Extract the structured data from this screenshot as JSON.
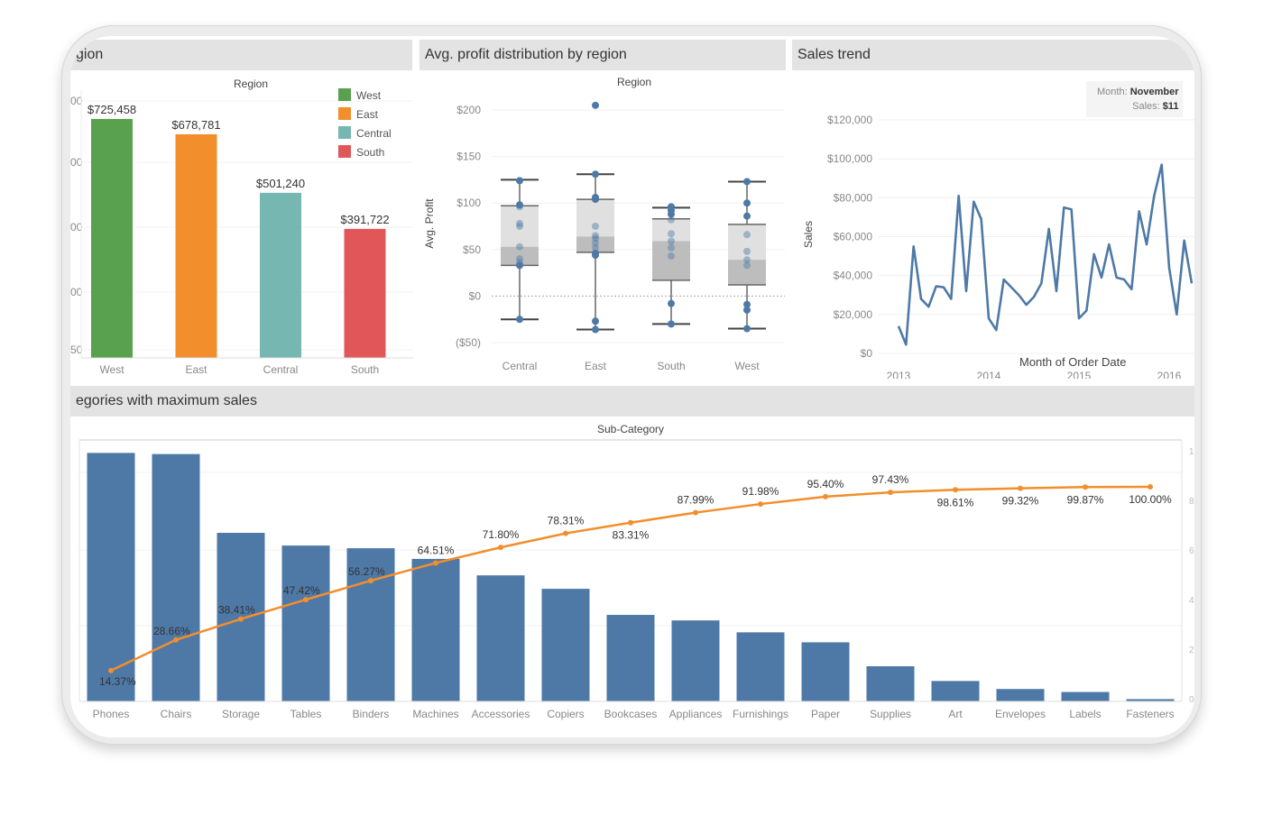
{
  "panels": {
    "region_sales": {
      "title": "gion"
    },
    "profit_box": {
      "title": "Avg. profit distribution by region"
    },
    "sales_trend": {
      "title": "Sales trend"
    },
    "pareto": {
      "title": "egories with maximum sales"
    }
  },
  "tooltip": {
    "month_label": "Month:",
    "month_value": "November",
    "sales_label": "Sales:",
    "sales_value": "$11"
  },
  "colors": {
    "West": "#59a14f",
    "East": "#f28e2b",
    "Central": "#76b7b2",
    "South": "#e15759",
    "line": "#4e79a7",
    "pareto_bar": "#4e79a7",
    "pareto_line": "#f28e2b",
    "box_upper": "#e0e0e0",
    "box_lower": "#bdbdbd"
  },
  "chart_data": [
    {
      "id": "region_sales",
      "type": "bar",
      "header": "Region",
      "categories": [
        "West",
        "East",
        "Central",
        "South"
      ],
      "values": [
        725458,
        678781,
        501240,
        391722
      ],
      "data_labels": [
        "$725,458",
        "$678,781",
        "$501,240",
        "$391,722"
      ],
      "ytick_labels_visible": [
        "00",
        "00",
        "00",
        "00",
        "50"
      ],
      "legend": [
        "West",
        "East",
        "Central",
        "South"
      ],
      "legend_position": "top-right",
      "ylim": [
        0,
        780000
      ]
    },
    {
      "id": "profit_box",
      "type": "box",
      "header": "Region",
      "ylabel": "Avg. Profit",
      "categories": [
        "Central",
        "East",
        "South",
        "West"
      ],
      "yticks": [
        200,
        150,
        100,
        50,
        0,
        -50
      ],
      "ytick_labels": [
        "$200",
        "$150",
        "$100",
        "$50",
        "$0",
        "($50)"
      ],
      "ylim": [
        -60,
        220
      ],
      "boxes": [
        {
          "whisker_low": -25,
          "q1": 33,
          "median": 53,
          "q3": 97,
          "whisker_high": 125,
          "points": [
            124,
            98,
            96,
            78,
            75,
            53,
            40,
            36,
            33,
            -25
          ]
        },
        {
          "whisker_low": -36,
          "q1": 47,
          "median": 64,
          "q3": 104,
          "whisker_high": 131,
          "points": [
            205,
            131,
            106,
            104,
            75,
            65,
            62,
            57,
            52,
            46,
            44,
            -27,
            -36
          ]
        },
        {
          "whisker_low": -30,
          "q1": 17,
          "median": 59,
          "q3": 83,
          "whisker_high": 95,
          "points": [
            96,
            92,
            88,
            82,
            67,
            59,
            52,
            43,
            -8,
            -30
          ]
        },
        {
          "whisker_low": -35,
          "q1": 12,
          "median": 39,
          "q3": 77,
          "whisker_high": 123,
          "points": [
            123,
            100,
            86,
            66,
            48,
            39,
            33,
            -9,
            -15,
            -35
          ]
        }
      ]
    },
    {
      "id": "sales_trend",
      "type": "line",
      "ylabel": "Sales",
      "xlabel": "Month of Order Date",
      "xtick_labels": [
        "2013",
        "2014",
        "2015",
        "2016"
      ],
      "yticks": [
        0,
        20000,
        40000,
        60000,
        80000,
        100000,
        120000
      ],
      "ytick_labels": [
        "$0",
        "$20,000",
        "$40,000",
        "$60,000",
        "$80,000",
        "$100,000",
        "$120,000"
      ],
      "ylim": [
        0,
        120000
      ],
      "x_start": "2013-01",
      "values": [
        14000,
        4500,
        55000,
        28000,
        24000,
        34500,
        34000,
        28000,
        81000,
        32000,
        78000,
        69000,
        18000,
        12000,
        38000,
        34000,
        30000,
        25000,
        29000,
        36000,
        64000,
        32000,
        75000,
        74000,
        18000,
        22000,
        51000,
        39000,
        56000,
        39000,
        38000,
        33000,
        73000,
        56000,
        81000,
        97000,
        44000,
        20000,
        58000,
        36000
      ]
    },
    {
      "id": "pareto",
      "type": "bar+line",
      "header": "Sub-Category",
      "categories": [
        "Phones",
        "Chairs",
        "Storage",
        "Tables",
        "Binders",
        "Machines",
        "Accessories",
        "Copiers",
        "Bookcases",
        "Appliances",
        "Furnishings",
        "Paper",
        "Supplies",
        "Art",
        "Envelopes",
        "Labels",
        "Fasteners"
      ],
      "bar_values": [
        330007,
        328449,
        223844,
        206966,
        203413,
        189239,
        167380,
        149528,
        114880,
        107532,
        91705,
        78479,
        46674,
        27119,
        16476,
        12486,
        3024
      ],
      "cumulative_pct": [
        14.37,
        28.66,
        38.41,
        47.42,
        56.27,
        64.51,
        71.8,
        78.31,
        83.31,
        87.99,
        91.98,
        95.4,
        97.43,
        98.61,
        99.32,
        99.87,
        100.0
      ],
      "pct_labels": [
        "14.37%",
        "28.66%",
        "38.41%",
        "47.42%",
        "56.27%",
        "64.51%",
        "71.80%",
        "78.31%",
        "83.31%",
        "87.99%",
        "91.98%",
        "95.40%",
        "97.43%",
        "98.61%",
        "99.32%",
        "99.87%",
        "100.00%"
      ],
      "right_axis_ticks_visible": [
        "1",
        "8",
        "6",
        "4",
        "2",
        "0"
      ],
      "ylim_left": [
        0,
        340000
      ],
      "ylim_right": [
        0,
        105
      ]
    }
  ]
}
